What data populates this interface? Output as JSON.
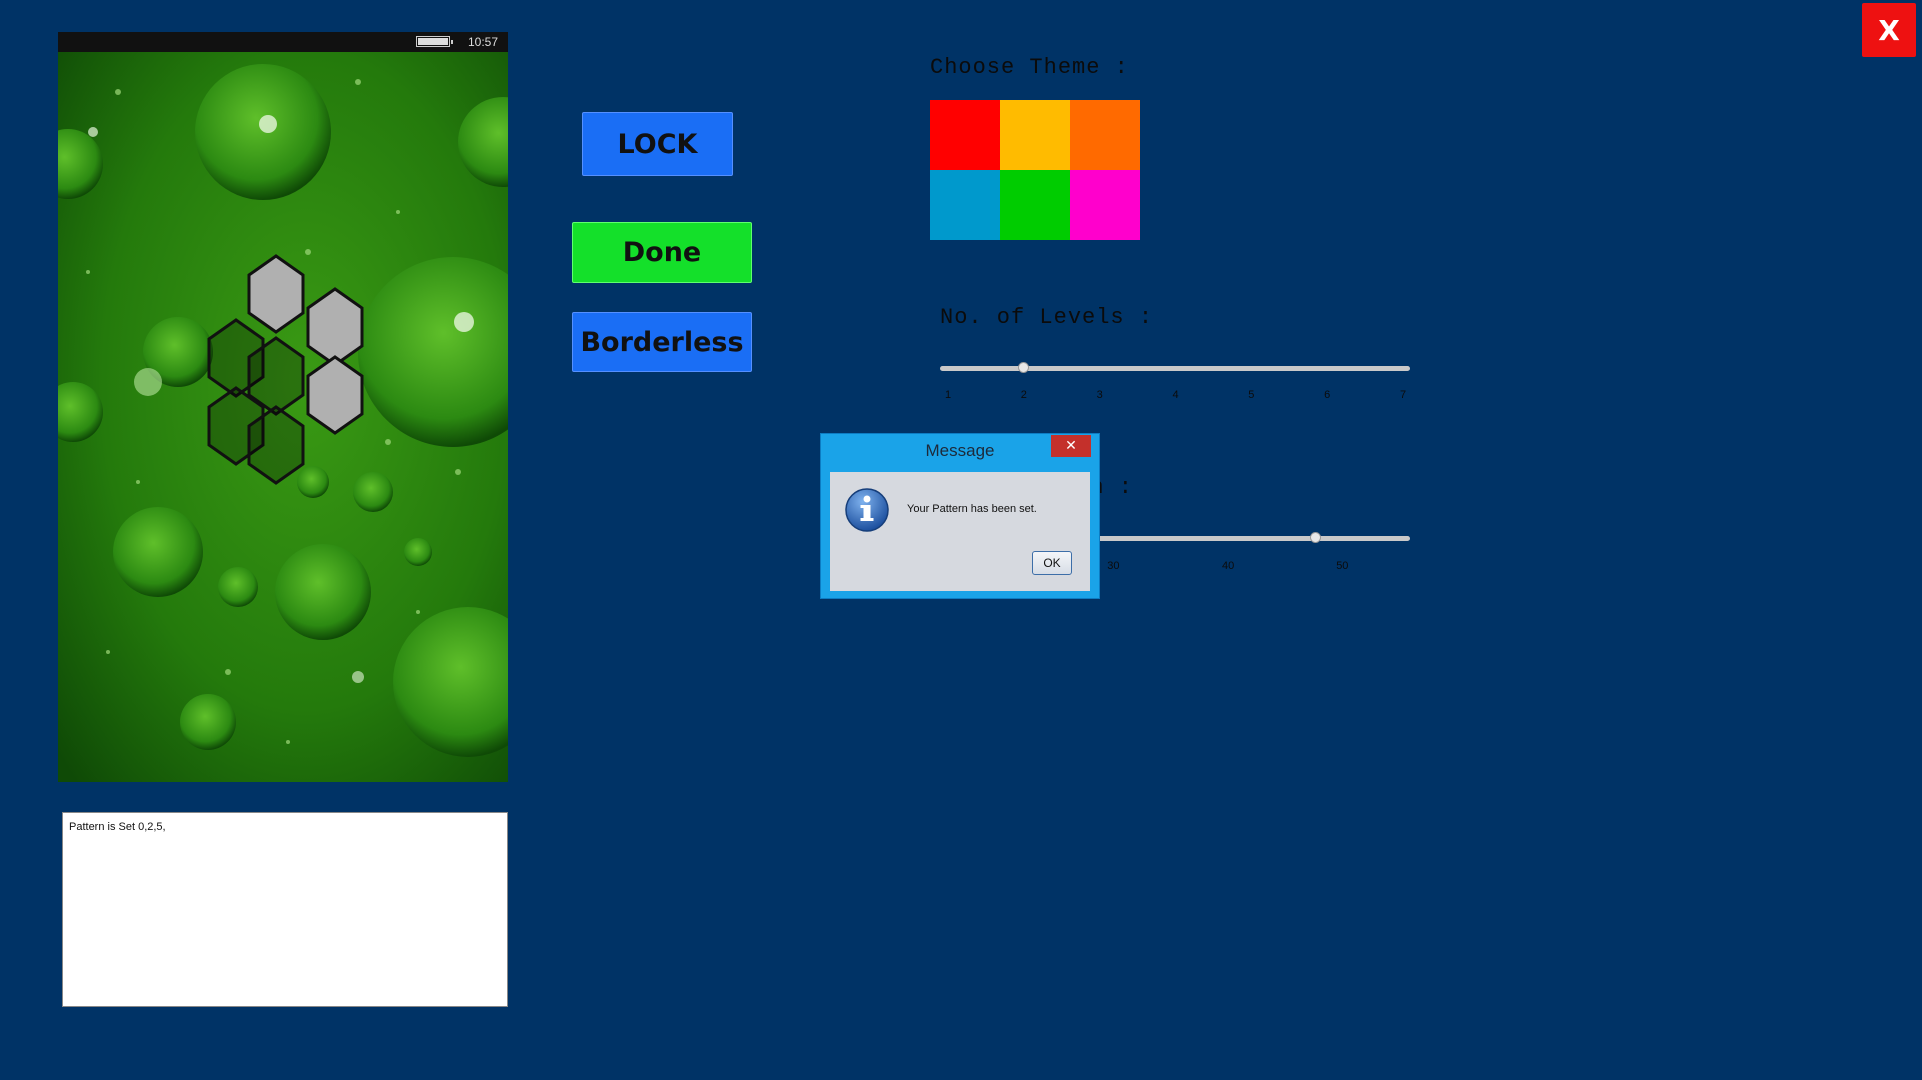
{
  "window": {
    "close_label": "X"
  },
  "phone": {
    "time": "10:57"
  },
  "log": {
    "text": "Pattern is Set 0,2,5,"
  },
  "buttons": {
    "lock": "LOCK",
    "done": "Done",
    "borderless": "Borderless"
  },
  "theme": {
    "heading": "Choose Theme :",
    "colors": [
      "#ff0000",
      "#ffbb00",
      "#ff6a00",
      "#0099cc",
      "#00cc00",
      "#ff00cc"
    ]
  },
  "levels": {
    "heading": "No. of Levels :",
    "min": 1,
    "max": 7,
    "value": 2,
    "ticks": [
      "1",
      "2",
      "3",
      "4",
      "5",
      "6",
      "7"
    ]
  },
  "length": {
    "heading_visible": "gth :",
    "min": 0,
    "max": 50,
    "value": 40,
    "ticks": [
      "30",
      "40",
      "50"
    ]
  },
  "dialog": {
    "title": "Message",
    "message": "Your Pattern has been set.",
    "ok": "OK",
    "close": "✕",
    "icon": "info-icon"
  },
  "pattern": {
    "selected": [
      0,
      2,
      5
    ]
  }
}
